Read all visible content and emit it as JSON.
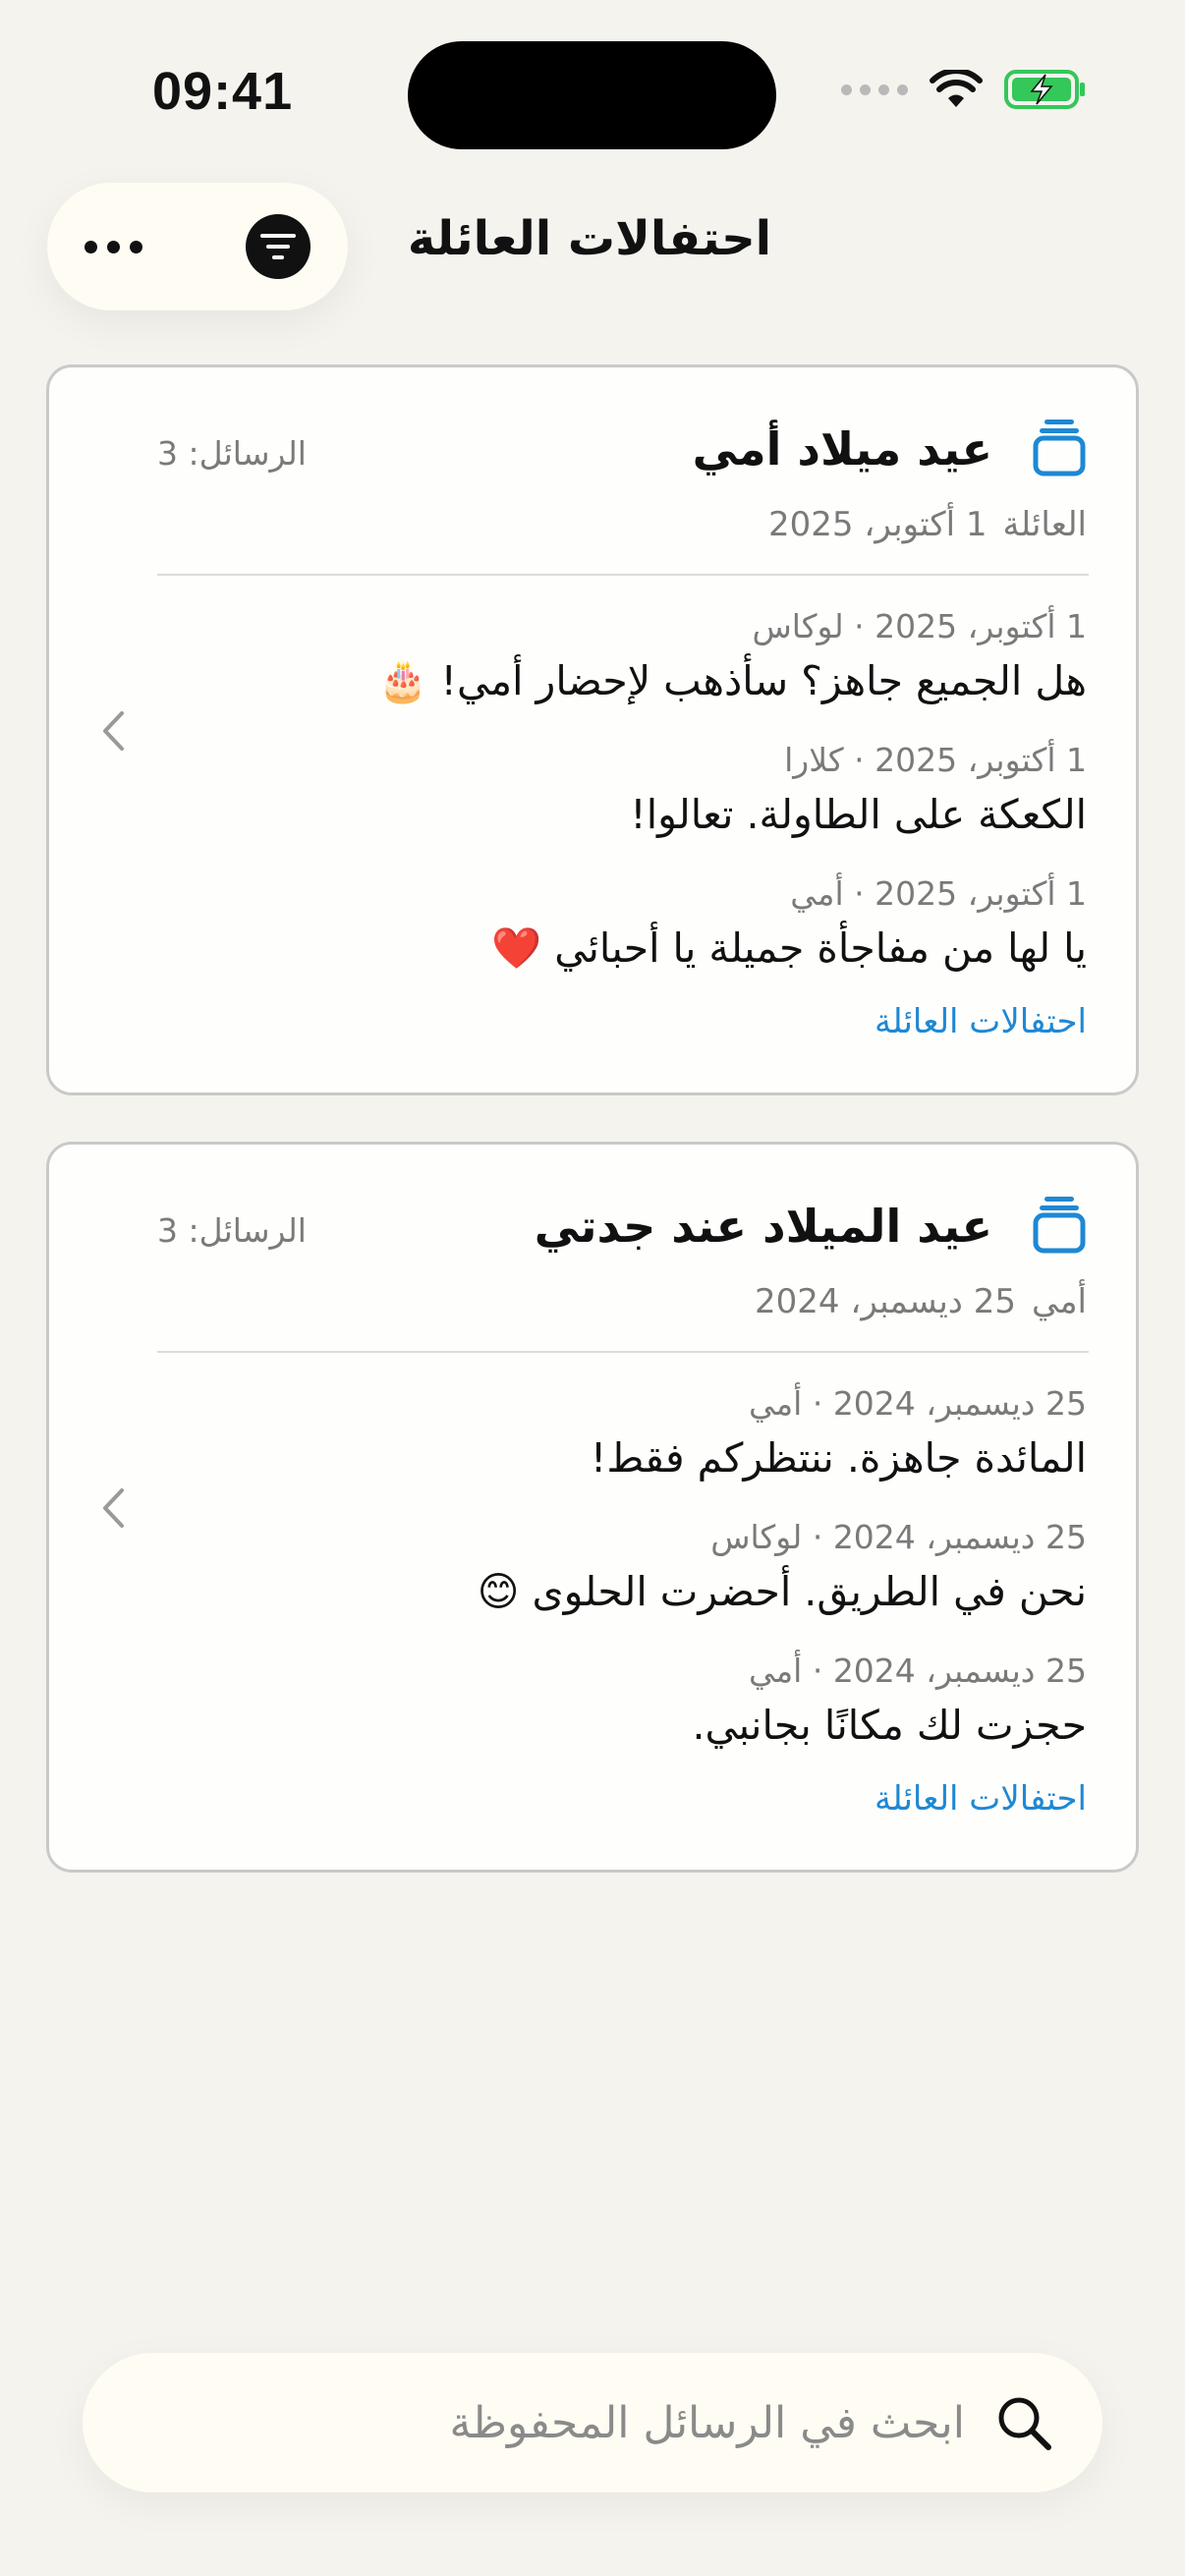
{
  "status_bar": {
    "time": "09:41"
  },
  "header": {
    "title": "احتفالات العائلة"
  },
  "colors": {
    "accent": "#1E88D4",
    "battery": "#34C759"
  },
  "cards": [
    {
      "title": "عيد ميلاد أمي",
      "message_count": "الرسائل: 3",
      "group": "العائلة",
      "date": "1 أكتوبر، 2025",
      "messages": [
        {
          "meta": "1 أكتوبر، 2025 · لوكاس",
          "text": "هل الجميع جاهز؟ سأذهب لإحضار أمي! 🎂"
        },
        {
          "meta": "1 أكتوبر، 2025 · كلارا",
          "text": "الكعكة على الطاولة. تعالوا!"
        },
        {
          "meta": "1 أكتوبر، 2025 · أمي",
          "text": "يا لها من مفاجأة جميلة يا أحبائي ❤️"
        }
      ],
      "link": "احتفالات العائلة"
    },
    {
      "title": "عيد الميلاد عند جدتي",
      "message_count": "الرسائل: 3",
      "group": "أمي",
      "date": "25 ديسمبر، 2024",
      "messages": [
        {
          "meta": "25 ديسمبر، 2024 · أمي",
          "text": "المائدة جاهزة. ننتظركم فقط!"
        },
        {
          "meta": "25 ديسمبر، 2024 · لوكاس",
          "text": "نحن في الطريق. أحضرت الحلوى 😊"
        },
        {
          "meta": "25 ديسمبر، 2024 · أمي",
          "text": "حجزت لك مكانًا بجانبي."
        }
      ],
      "link": "احتفالات العائلة"
    }
  ],
  "search": {
    "placeholder": "ابحث في الرسائل المحفوظة"
  }
}
